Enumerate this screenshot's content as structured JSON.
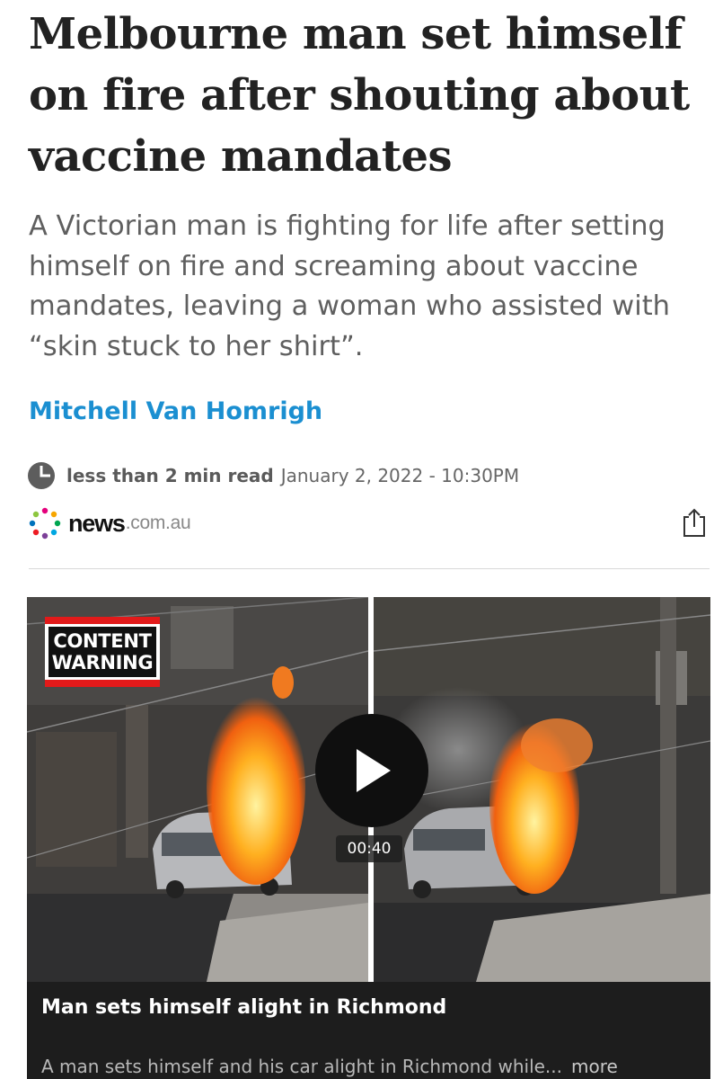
{
  "article": {
    "headline": "Melbourne man set himself on fire after shouting about vaccine mandates",
    "standfirst": "A Victorian man is fighting for life after setting himself on fire and screaming about vaccine mandates, leaving a woman who assisted with “skin stuck to her shirt”.",
    "author": "Mitchell Van Homrigh",
    "read_time": "less than 2 min read",
    "published": "January 2, 2022 - 10:30PM"
  },
  "source": {
    "logo_word": "news",
    "logo_domain": ".com.au",
    "logo_icon": "news-dots-logo-icon",
    "share_icon": "share-icon",
    "clock_icon": "clock-icon"
  },
  "video": {
    "warning_line1": "CONTENT",
    "warning_line2": "WARNING",
    "duration": "00:40",
    "play_icon": "play-icon",
    "title": "Man sets himself alight in Richmond",
    "description": "A man sets himself and his car alight in Richmond while...",
    "more_label": "more"
  },
  "colors": {
    "author_link": "#1b8fd1",
    "warning_red": "#e21a1a",
    "card_bg": "#1d1d1d"
  }
}
